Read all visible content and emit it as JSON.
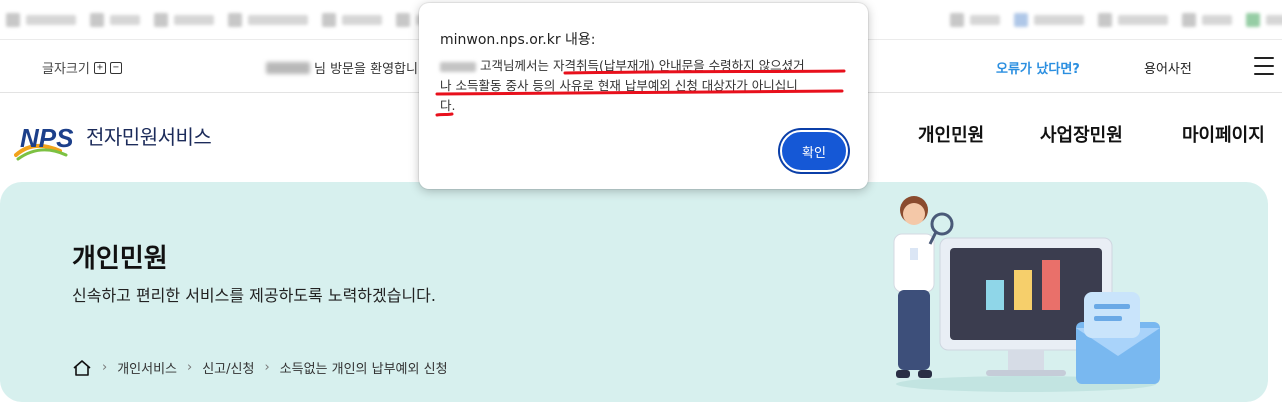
{
  "utility": {
    "font_size_label": "글자크기",
    "font_plus": "+",
    "font_minus": "−",
    "welcome_text": "님 방문을 환영합니",
    "error_link": "오류가 났다면?",
    "glossary": "용어사전"
  },
  "header": {
    "logo_mark": "NPS",
    "logo_text": "전자민원서비스",
    "nav": [
      "개인민원",
      "사업장민원",
      "마이페이지"
    ]
  },
  "hero": {
    "title": "개인민원",
    "description": "신속하고 편리한 서비스를 제공하도록 노력하겠습니다.",
    "breadcrumb": [
      "개인서비스",
      "신고/신청",
      "소득없는 개인의 납부예외 신청"
    ]
  },
  "dialog": {
    "origin": "minwon.nps.or.kr 내용:",
    "message_prefix": "고객님께서는",
    "message_line1": "자격취득(납부재개) 안내문을 수령하지 않으셨거",
    "message_line2": "나 소득활동 중사 등의 사유로 현재 납부예외 신청 대상자가 아니십니",
    "message_line3": "다.",
    "ok_label": "확인"
  },
  "colors": {
    "hero_bg": "#d7f0ee",
    "ok_button": "#1558d6",
    "error_link": "#2b8fe0",
    "annotation_red": "#e8101c"
  }
}
